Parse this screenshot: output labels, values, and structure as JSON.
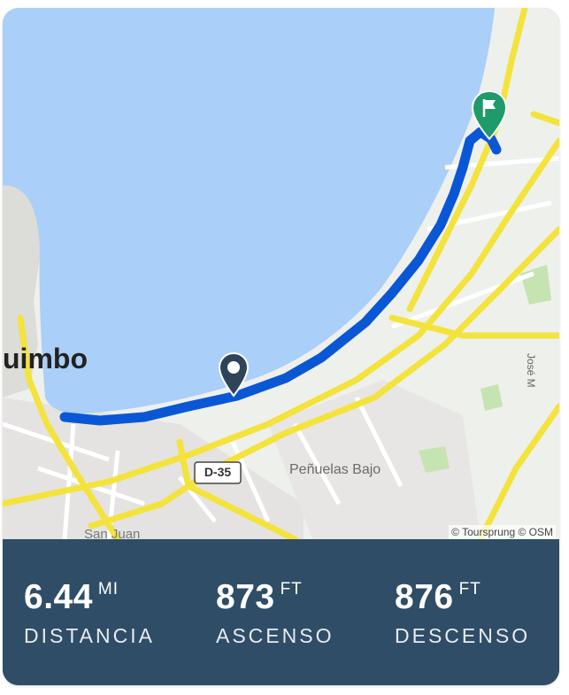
{
  "map": {
    "city_label": "uimbo",
    "place_label": "Peñuelas Bajo",
    "place_label_2": "San Juan",
    "street_label": "José M",
    "road_shield": "D-35",
    "attribution": "© Toursprung © OSM",
    "icons": {
      "start": "start-pin-icon",
      "finish": "finish-flag-pin-icon"
    },
    "colors": {
      "water": "#aacff8",
      "route": "#0a57d6",
      "major_road": "#f3e33c",
      "finish_pin": "#1f9b6b",
      "start_pin": "#2f4459"
    }
  },
  "stats": [
    {
      "value": "6.44",
      "unit": "MI",
      "label": "DISTANCIA"
    },
    {
      "value": "873",
      "unit": "FT",
      "label": "ASCENSO"
    },
    {
      "value": "876",
      "unit": "FT",
      "label": "DESCENSO"
    }
  ],
  "colors": {
    "stats_bg": "#2f4d66",
    "stats_text": "#ffffff"
  }
}
